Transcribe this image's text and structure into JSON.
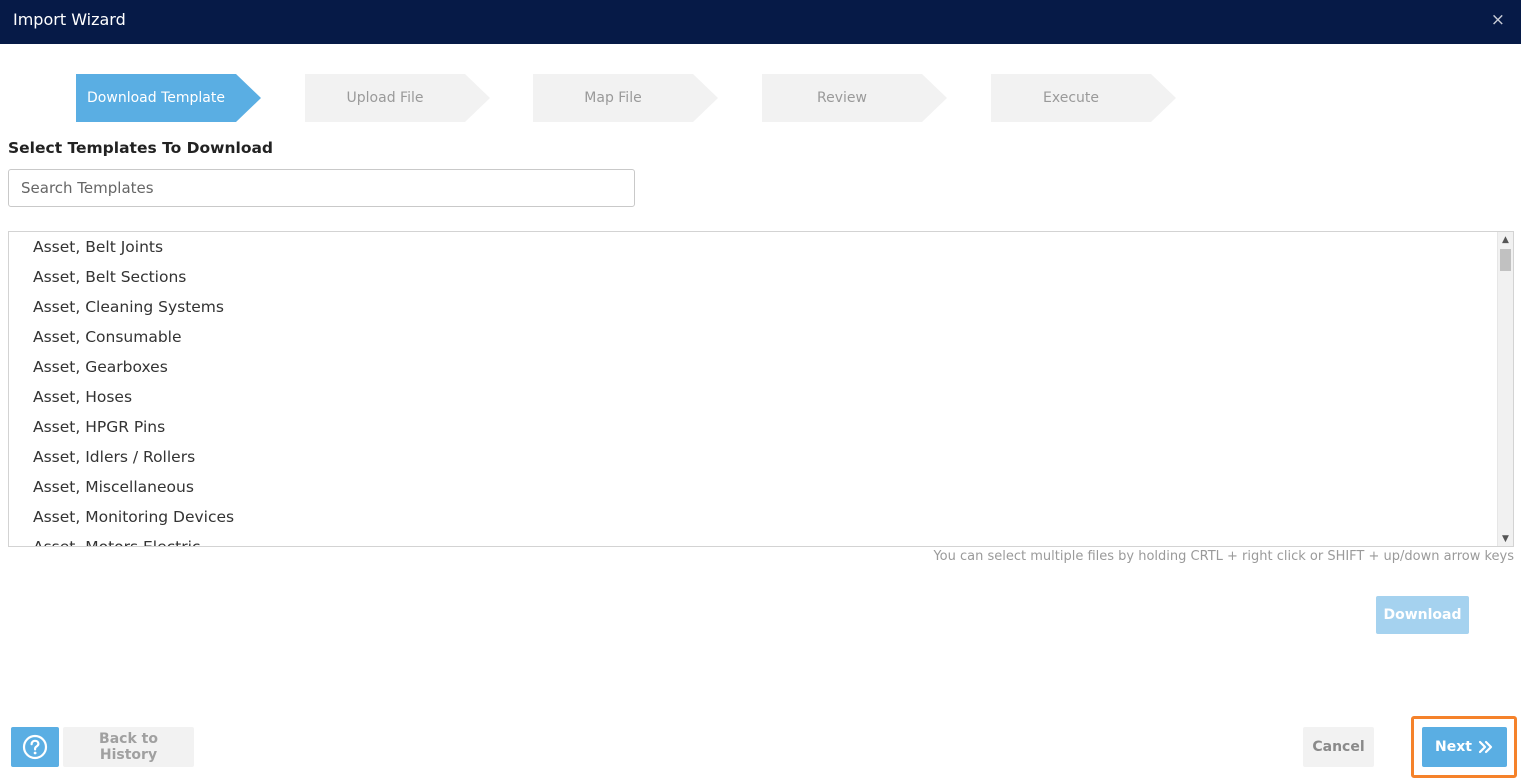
{
  "window": {
    "title": "Import Wizard",
    "close_glyph": "×"
  },
  "steps": [
    {
      "label": "Download Template",
      "active": true
    },
    {
      "label": "Upload File",
      "active": false
    },
    {
      "label": "Map File",
      "active": false
    },
    {
      "label": "Review",
      "active": false
    },
    {
      "label": "Execute",
      "active": false
    }
  ],
  "templates": {
    "section_label": "Select Templates To Download",
    "search_placeholder": "Search Templates",
    "items": [
      "Asset, Belt Joints",
      "Asset, Belt Sections",
      "Asset, Cleaning Systems",
      "Asset, Consumable",
      "Asset, Gearboxes",
      "Asset, Hoses",
      "Asset, HPGR Pins",
      "Asset, Idlers / Rollers",
      "Asset, Miscellaneous",
      "Asset, Monitoring Devices",
      "Asset, Motors Electric"
    ],
    "hint": "You can select multiple files by holding CRTL + right click or SHIFT + up/down arrow keys",
    "download_label": "Download"
  },
  "footer": {
    "help_icon": "question-circle-icon",
    "back_label": "Back to History",
    "cancel_label": "Cancel",
    "next_label": "Next",
    "next_icon": "double-chevron-right-icon"
  },
  "colors": {
    "titlebar": "#061a47",
    "accent": "#5aaee3",
    "highlight": "#f5822a"
  }
}
